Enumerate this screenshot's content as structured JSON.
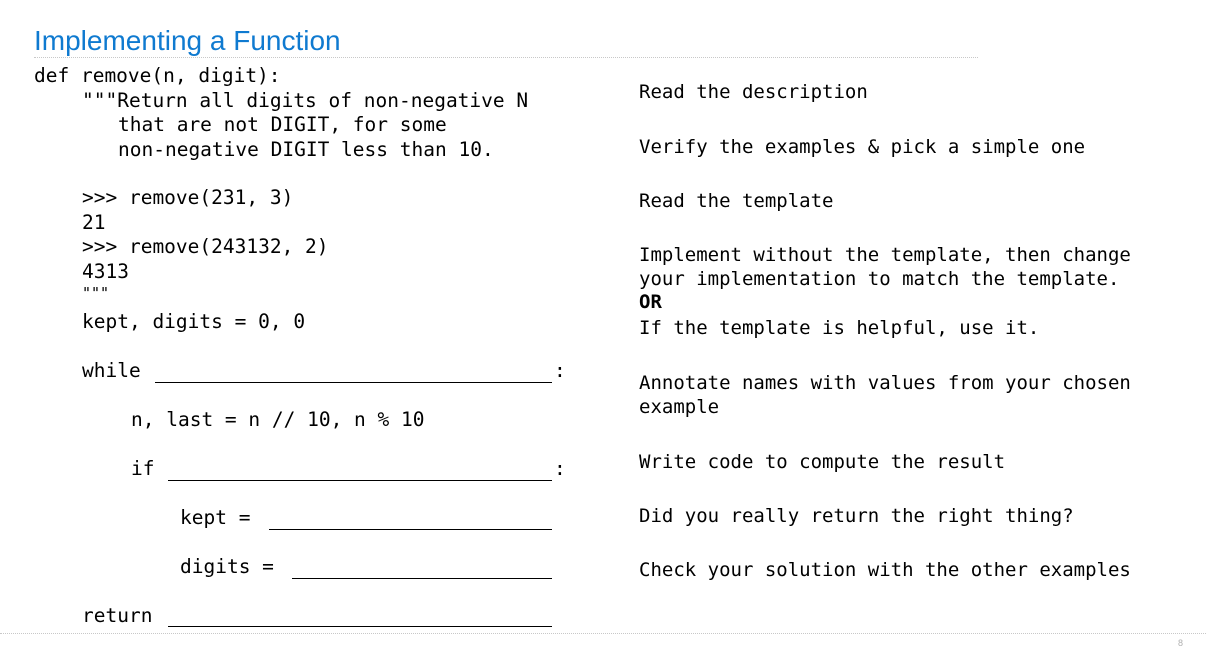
{
  "slide": {
    "title": "Implementing a Function",
    "page_number": "8",
    "title_color": "#0f7ad0"
  },
  "code": {
    "line_def": "def remove(n, digit):",
    "line_doc1": "\"\"\"Return all digits of non-negative N",
    "line_doc2": "that are not DIGIT, for some",
    "line_doc3": "non-negative DIGIT less than 10.",
    "line_ex1": ">>> remove(231, 3)",
    "line_out1": "21",
    "line_ex2": ">>> remove(243132, 2)",
    "line_out2": "4313",
    "line_docend": "\"\"\"",
    "line_init": "kept, digits = 0, 0",
    "line_while": "while",
    "line_while_colon": ":",
    "line_split": "n, last = n // 10, n % 10",
    "line_if": "if",
    "line_if_colon": ":",
    "line_kept": "kept =",
    "line_digits": "digits =",
    "line_return": "return"
  },
  "steps": {
    "s1": "Read the description",
    "s2": "Verify the examples & pick a simple one",
    "s3": "Read the template",
    "s4a": "Implement without the template, then change",
    "s4b": "your implementation to match the template.",
    "s4c": "OR",
    "s4d": "If the template is helpful, use it.",
    "s5a": "Annotate names with values from your chosen",
    "s5b": "example",
    "s6": "Write code to compute the result",
    "s7": "Did you really return the right thing?",
    "s8": "Check your solution with the other examples"
  }
}
